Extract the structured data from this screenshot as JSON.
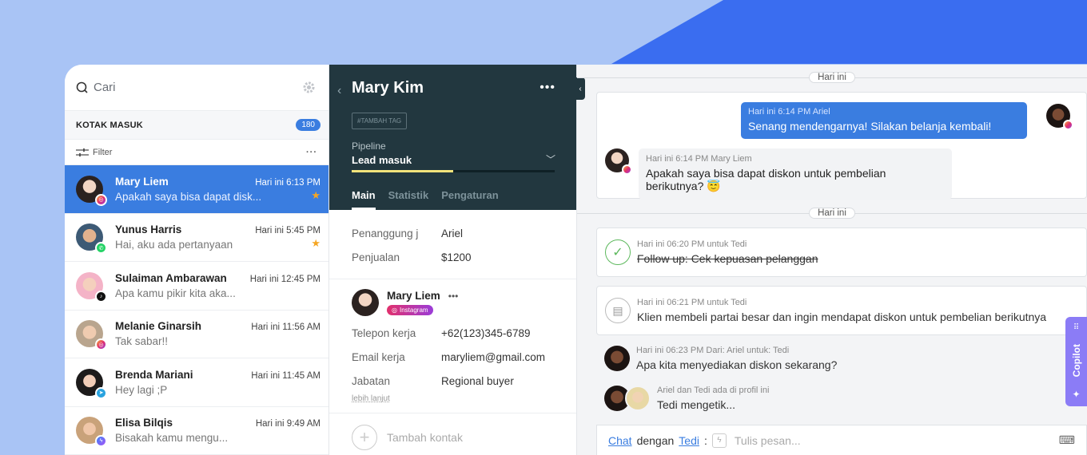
{
  "colors": {
    "accent": "#3a7de0",
    "dark_header": "#22373f",
    "copilot": "#8b7cf6",
    "star": "#f5a623"
  },
  "inbox": {
    "search_placeholder": "Cari",
    "section_title": "KOTAK MASUK",
    "count": "180",
    "filter_label": "Filter",
    "conversations": [
      {
        "name": "Mary Liem",
        "time": "Hari ini 6:13 PM",
        "preview": "Apakah saya bisa dapat disk...",
        "channel": "instagram",
        "starred": true,
        "active": true
      },
      {
        "name": "Yunus Harris",
        "time": "Hari ini 5:45 PM",
        "preview": "Hai, aku ada pertanyaan",
        "channel": "whatsapp",
        "starred": true
      },
      {
        "name": "Sulaiman Ambarawan",
        "time": "Hari ini 12:45 PM",
        "preview": "Apa kamu pikir kita aka...",
        "channel": "tiktok"
      },
      {
        "name": "Melanie Ginarsih",
        "time": "Hari ini 11:56 AM",
        "preview": "Tak sabar!!",
        "channel": "instagram"
      },
      {
        "name": "Brenda Mariani",
        "time": "Hari ini 11:45 AM",
        "preview": "Hey lagi ;P",
        "channel": "telegram"
      },
      {
        "name": "Elisa Bilqis",
        "time": "Hari ini 9:49 AM",
        "preview": "Bisakah kamu mengu...",
        "channel": "messenger"
      }
    ]
  },
  "profile": {
    "name": "Mary Kim",
    "tag_button": "#TAMBAH TAG",
    "pipeline_label": "Pipeline",
    "pipeline_value": "Lead masuk",
    "pipeline_progress": 0.5,
    "tabs": [
      "Main",
      "Statistik",
      "Pengaturan"
    ],
    "fields": [
      {
        "key": "Penanggung j",
        "value": "Ariel"
      },
      {
        "key": "Penjualan",
        "value": "$1200"
      }
    ],
    "contact": {
      "name": "Mary Liem",
      "channel": "Instagram",
      "fields": [
        {
          "key": "Telepon kerja",
          "value": "+62(123)345-6789"
        },
        {
          "key": "Email kerja",
          "value": "maryliem@gmail.com"
        },
        {
          "key": "Jabatan",
          "value": "Regional buyer"
        }
      ],
      "more_link": "lebih lanjut"
    },
    "add_contact": "Tambah kontak"
  },
  "chat": {
    "day_label_1": "Hari ini",
    "day_label_2": "Hari ini",
    "outgoing": {
      "meta": "Hari ini 6:14 PM Ariel",
      "text": "Senang mendengarnya! Silakan belanja kembali!"
    },
    "incoming": {
      "meta": "Hari ini 6:14 PM Mary Liem",
      "text": "Apakah saya bisa dapat diskon untuk pembelian berikutnya? 😇"
    },
    "task": {
      "meta": "Hari ini 06:20 PM untuk Tedi",
      "text": "Follow up: Cek kepuasan pelanggan"
    },
    "note": {
      "meta": "Hari ini 06:21 PM untuk Tedi",
      "text": "Klien membeli partai besar dan ingin mendapat diskon untuk pembelian berikutnya"
    },
    "internal": {
      "meta": "Hari ini 06:23 PM Dari: Ariel untuk: Tedi",
      "text": "Apa kita menyediakan diskon sekarang?"
    },
    "typing": {
      "meta": "Ariel dan Tedi ada di profil ini",
      "text": "Tedi mengetik..."
    },
    "compose": {
      "channel_link": "Chat",
      "with_label": "dengan",
      "recipient_link": "Tedi",
      "colon": ":",
      "placeholder": "Tulis pesan..."
    },
    "copilot_label": "Copilot"
  }
}
